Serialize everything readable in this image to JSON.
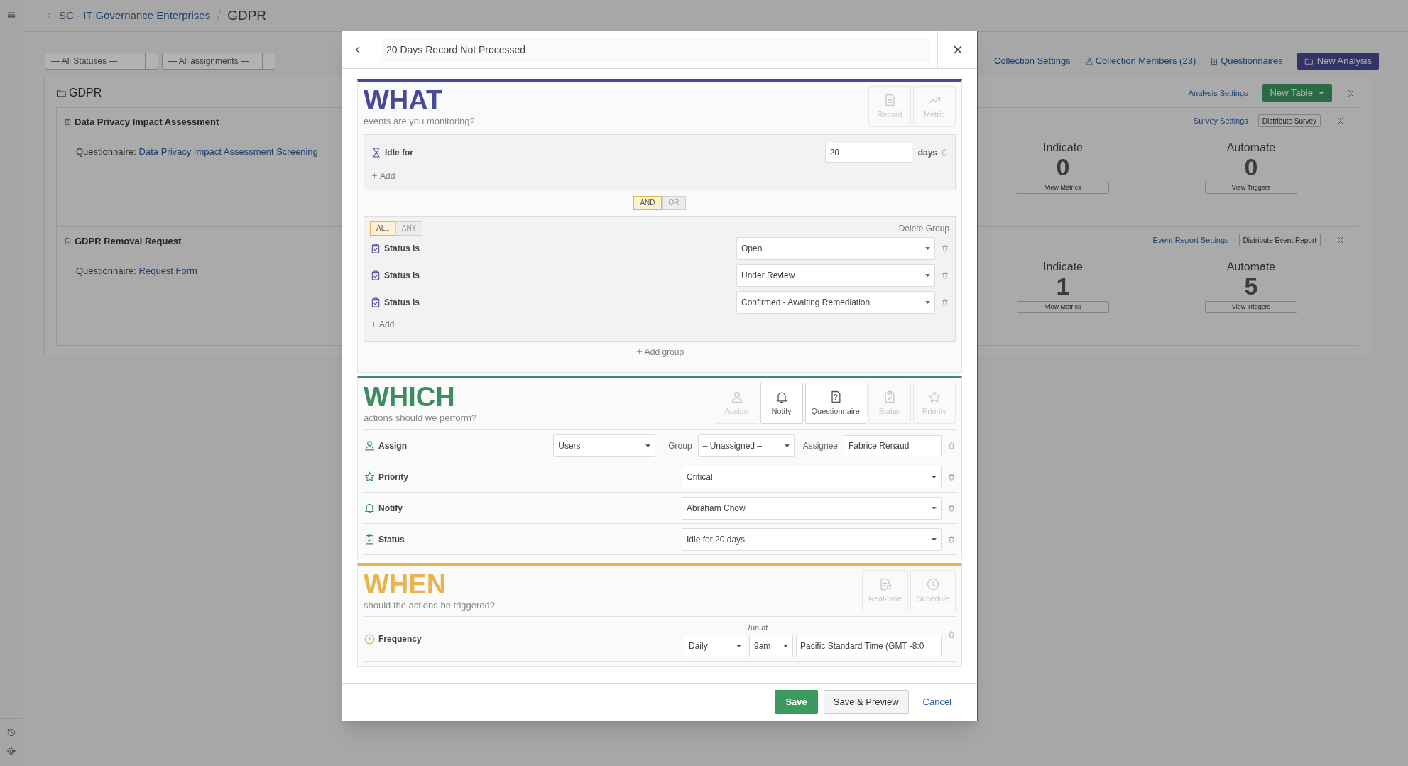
{
  "breadcrumb": {
    "parent": "SC - IT Governance Enterprises",
    "current": "GDPR"
  },
  "filters": [
    "— All Statuses —",
    "— All assignments —"
  ],
  "toolbar": {
    "links": [
      {
        "label": "Collection Settings",
        "kind": "plain"
      },
      {
        "label": "Collection Members (23)",
        "kind": "person"
      },
      {
        "label": "Questionnaires",
        "kind": "question"
      }
    ],
    "primary": "New Analysis"
  },
  "panel": {
    "title": "GDPR",
    "settings_link": "Analysis Settings",
    "new_button": "New Table",
    "cards": [
      {
        "title": "Data Privacy Impact Assessment",
        "kind": "survey",
        "questionnaire_label": "Questionnaire:",
        "questionnaire_link": "Data Privacy Impact Assessment Screening",
        "settings_link": "Survey Settings",
        "distribute": "Distribute Survey",
        "stats": [
          {
            "label": "Indicate",
            "value": "0",
            "button": "View Metrics"
          },
          {
            "label": "Automate",
            "value": "0",
            "button": "View Triggers"
          }
        ]
      },
      {
        "title": "GDPR Removal Request",
        "kind": "event_report",
        "questionnaire_label": "Questionnaire:",
        "questionnaire_link": "Request Form",
        "settings_link": "Event Report Settings",
        "distribute": "Distribute Event Report",
        "stats": [
          {
            "label": "Indicate",
            "value": "1",
            "button": "View Metrics"
          },
          {
            "label": "Automate",
            "value": "5",
            "button": "View Triggers"
          }
        ]
      }
    ]
  },
  "modal": {
    "title": "20 Days Record Not Processed",
    "what": {
      "heading": "WHAT",
      "subheading": "events are you monitoring?",
      "types": [
        {
          "label": "Record",
          "kind": "document",
          "disabled": true
        },
        {
          "label": "Metric",
          "kind": "trend",
          "disabled": true
        }
      ],
      "idle": {
        "label": "Idle for",
        "value": "20",
        "unit": "days"
      },
      "add": "Add",
      "joiner": [
        {
          "label": "AND",
          "selected": true
        },
        {
          "label": "OR",
          "selected": false
        }
      ],
      "group": {
        "match": [
          {
            "label": "ALL",
            "selected": true
          },
          {
            "label": "ANY",
            "selected": false
          }
        ],
        "delete": "Delete Group",
        "conditions": [
          {
            "label": "Status is",
            "value": "Open"
          },
          {
            "label": "Status is",
            "value": "Under Review"
          },
          {
            "label": "Status is",
            "value": "Confirmed - Awaiting Remediation"
          }
        ],
        "add": "Add"
      },
      "add_group": "Add group"
    },
    "which": {
      "heading": "WHICH",
      "subheading": "actions should we perform?",
      "types": [
        {
          "label": "Assign",
          "kind": "person",
          "disabled": true
        },
        {
          "label": "Notify",
          "kind": "bell",
          "disabled": false
        },
        {
          "label": "Questionnaire",
          "kind": "question",
          "disabled": false
        },
        {
          "label": "Status",
          "kind": "clipboard",
          "disabled": true
        },
        {
          "label": "Priority",
          "kind": "star",
          "disabled": true
        }
      ],
      "actions": [
        {
          "kind": "assign",
          "label": "Assign",
          "type": "Users",
          "group_label": "Group",
          "group": "– Unassigned –",
          "assignee_label": "Assignee",
          "assignee": "Fabrice Renaud"
        },
        {
          "kind": "priority",
          "label": "Priority",
          "value": "Critical"
        },
        {
          "kind": "notify",
          "label": "Notify",
          "value": "Abraham Chow"
        },
        {
          "kind": "status",
          "label": "Status",
          "value": "Idle for 20 days"
        }
      ]
    },
    "when": {
      "heading": "WHEN",
      "subheading": "should the actions be triggered?",
      "types": [
        {
          "label": "Real-time",
          "kind": "realtime",
          "disabled": true
        },
        {
          "label": "Schedule",
          "kind": "clock",
          "disabled": true
        }
      ],
      "schedule": {
        "label": "Frequency",
        "run_at_label": "Run at",
        "frequency": "Daily",
        "time": "9am",
        "timezone": "Pacific Standard Time (GMT -8:0"
      }
    },
    "footer": {
      "save": "Save",
      "save_preview": "Save & Preview",
      "cancel": "Cancel"
    }
  }
}
